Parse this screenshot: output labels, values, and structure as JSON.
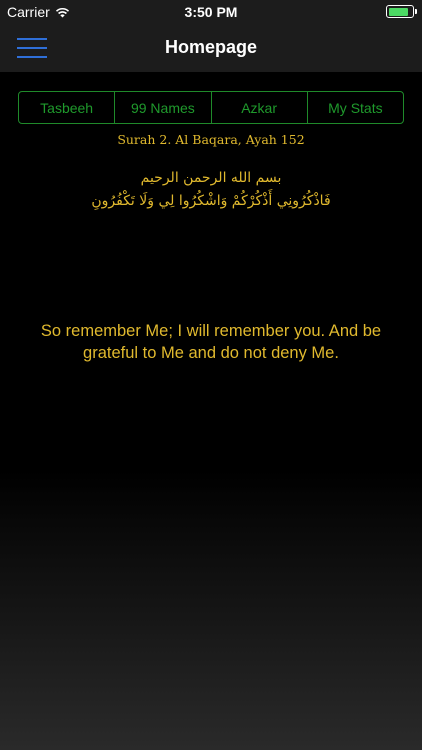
{
  "status_bar": {
    "carrier": "Carrier",
    "time": "3:50 PM",
    "battery_level": 0.85
  },
  "nav": {
    "title": "Homepage",
    "menu_icon": "hamburger-menu-icon"
  },
  "tabs": [
    {
      "label": "Tasbeeh"
    },
    {
      "label": "99 Names"
    },
    {
      "label": "Azkar"
    },
    {
      "label": "My Stats"
    }
  ],
  "ayah": {
    "reference": "Surah 2. Al Baqara, Ayah 152",
    "bismillah": "بسم الله الرحمن الرحيم",
    "arabic": "فَاذْكُرُونِي أَذْكُرْكُمْ وَاشْكُرُوا لِي وَلَا تَكْفُرُونِ",
    "translation": "So remember Me; I will remember you. And be grateful to Me and do not deny Me."
  },
  "colors": {
    "accent_gold": "#e0b92e",
    "tab_green": "#1f9a2c",
    "menu_blue": "#2f6fd8"
  }
}
